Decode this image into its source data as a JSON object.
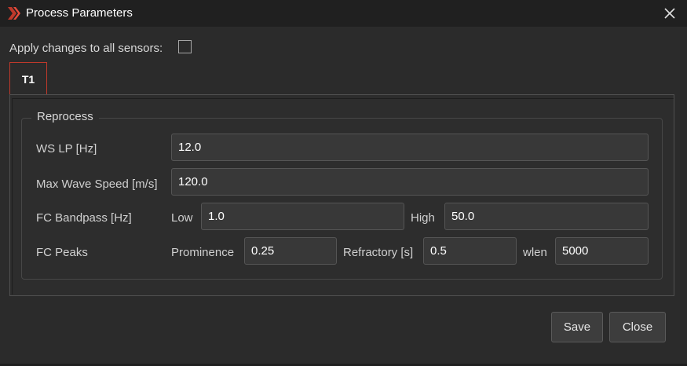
{
  "window": {
    "title": "Process Parameters",
    "accent": "#c0392b"
  },
  "apply": {
    "label": "Apply changes to all sensors:",
    "checked": false
  },
  "tabs": [
    {
      "label": "T1",
      "selected": true
    }
  ],
  "reprocess": {
    "group_title": "Reprocess",
    "ws_lp": {
      "label": "WS LP [Hz]",
      "value": "12.0"
    },
    "max_wave_speed": {
      "label": "Max Wave Speed [m/s]",
      "value": "120.0"
    },
    "fc_bandpass": {
      "label": "FC Bandpass [Hz]",
      "low_label": "Low",
      "low_value": "1.0",
      "high_label": "High",
      "high_value": "50.0"
    },
    "fc_peaks": {
      "label": "FC Peaks",
      "prominence_label": "Prominence",
      "prominence_value": "0.25",
      "refractory_label": "Refractory [s]",
      "refractory_value": "0.5",
      "wlen_label": "wlen",
      "wlen_value": "5000"
    }
  },
  "buttons": {
    "save": "Save",
    "close": "Close"
  },
  "icons": {
    "app": "red-chevron-logo-icon",
    "close": "close-icon"
  }
}
